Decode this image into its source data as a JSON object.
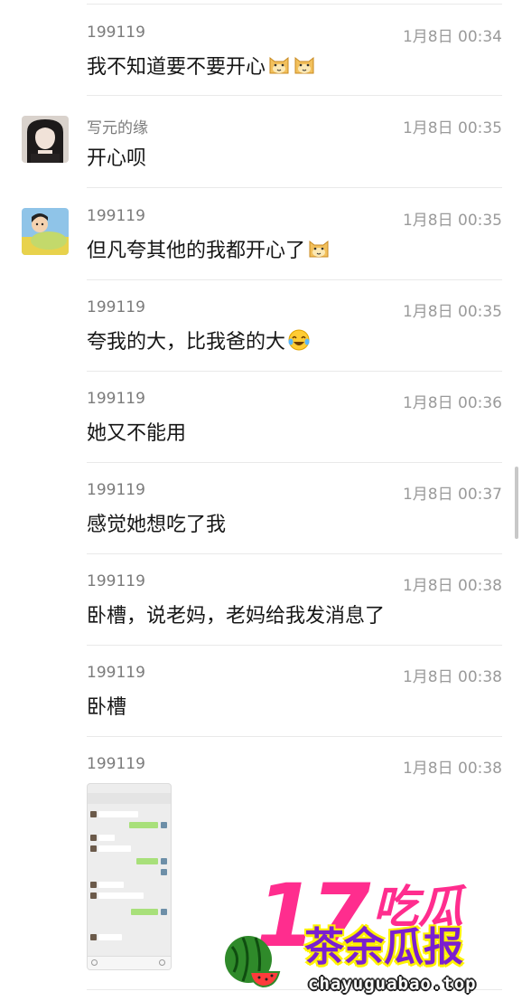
{
  "messages": [
    {
      "sender": "199119",
      "time": "1月8日 00:34",
      "text": "我不知道要不要开心",
      "emoji": [
        "doge",
        "doge"
      ],
      "avatar": null
    },
    {
      "sender": "写元的缘",
      "time": "1月8日 00:35",
      "text": "开心呗",
      "emoji": [],
      "avatar": "girl-avatar"
    },
    {
      "sender": "199119",
      "time": "1月8日 00:35",
      "text": "但凡夸其他的我都开心了",
      "emoji": [
        "doge"
      ],
      "avatar": "cartoon-avatar"
    },
    {
      "sender": "199119",
      "time": "1月8日 00:35",
      "text": "夸我的大，比我爸的大",
      "emoji": [
        "laugh-cry"
      ],
      "avatar": null
    },
    {
      "sender": "199119",
      "time": "1月8日 00:36",
      "text": "她又不能用",
      "emoji": [],
      "avatar": null
    },
    {
      "sender": "199119",
      "time": "1月8日 00:37",
      "text": "感觉她想吃了我",
      "emoji": [],
      "avatar": null
    },
    {
      "sender": "199119",
      "time": "1月8日 00:38",
      "text": "卧槽，说老妈，老妈给我发消息了",
      "emoji": [],
      "avatar": null
    },
    {
      "sender": "199119",
      "time": "1月8日 00:38",
      "text": "卧槽",
      "emoji": [],
      "avatar": null
    },
    {
      "sender": "199119",
      "time": "1月8日 00:38",
      "text": "",
      "emoji": [],
      "avatar": null
    }
  ],
  "watermark": {
    "number": "17",
    "top": "吃瓜",
    "middle": "茶余瓜报",
    "url": "chayuguabao.top"
  },
  "colors": {
    "pink": "#ff2d8e",
    "purple": "#7a1fd0",
    "yellow": "#fff200"
  }
}
